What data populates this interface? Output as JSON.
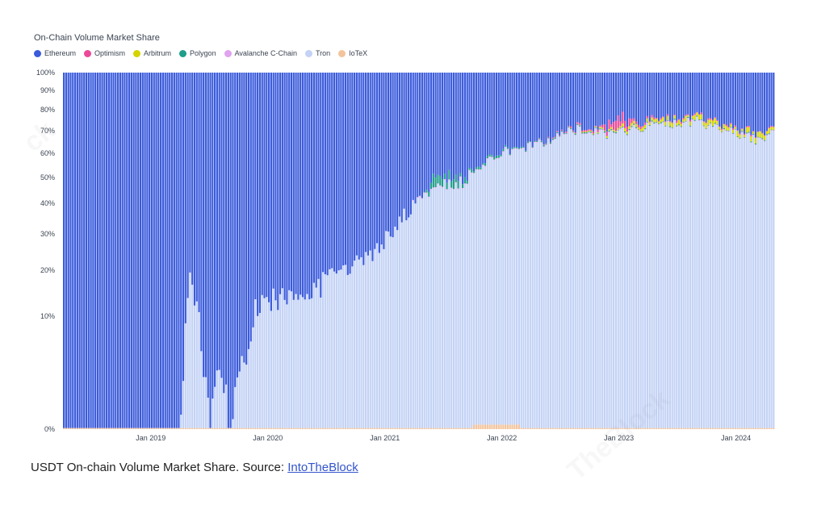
{
  "chart_data": {
    "type": "bar",
    "stacked": true,
    "title": "On-Chain Volume Market Share",
    "y_tick_labels": [
      "0%",
      "10%",
      "20%",
      "30%",
      "40%",
      "50%",
      "60%",
      "70%",
      "80%",
      "90%",
      "100%"
    ],
    "y_tick_values": [
      0,
      10,
      20,
      30,
      40,
      50,
      60,
      70,
      80,
      90,
      100
    ],
    "x_tick_labels": [
      "Jan 2019",
      "Jan 2020",
      "Jan 2021",
      "Jan 2022",
      "Jan 2023",
      "Jan 2024"
    ],
    "x_range": [
      "2018-04",
      "2024-05"
    ],
    "legend_position": "top-left",
    "series": [
      {
        "name": "Ethereum",
        "color": "#3b5bdb"
      },
      {
        "name": "Optimism",
        "color": "#ec4899"
      },
      {
        "name": "Arbitrum",
        "color": "#d4d400"
      },
      {
        "name": "Polygon",
        "color": "#1f9e89"
      },
      {
        "name": "Avalanche C-Chain",
        "color": "#e0a3ef"
      },
      {
        "name": "Tron",
        "color": "#c3d2f5"
      },
      {
        "name": "IoTeX",
        "color": "#f3c49b"
      }
    ],
    "tron_share_anchors": [
      [
        "2018-04",
        0
      ],
      [
        "2019-04",
        0
      ],
      [
        "2019-05",
        18
      ],
      [
        "2019-06",
        8
      ],
      [
        "2019-07",
        1
      ],
      [
        "2019-08",
        3
      ],
      [
        "2019-09",
        1
      ],
      [
        "2019-11",
        9
      ],
      [
        "2019-12",
        12
      ],
      [
        "2020-03",
        14
      ],
      [
        "2020-06",
        16
      ],
      [
        "2020-09",
        20
      ],
      [
        "2020-12",
        24
      ],
      [
        "2021-03",
        36
      ],
      [
        "2021-06",
        46
      ],
      [
        "2021-09",
        48
      ],
      [
        "2021-12",
        58
      ],
      [
        "2022-03",
        62
      ],
      [
        "2022-06",
        66
      ],
      [
        "2022-09",
        71
      ],
      [
        "2022-12",
        68
      ],
      [
        "2023-03",
        71
      ],
      [
        "2023-06",
        73
      ],
      [
        "2023-09",
        74
      ],
      [
        "2023-12",
        70
      ],
      [
        "2024-03",
        66
      ],
      [
        "2024-05",
        68
      ]
    ],
    "polygon_share_anchors": [
      [
        "2021-05",
        0
      ],
      [
        "2021-06",
        4
      ],
      [
        "2021-08",
        3
      ],
      [
        "2021-10",
        1
      ],
      [
        "2022-03",
        0.5
      ],
      [
        "2024-05",
        0.3
      ]
    ],
    "arbitrum_share_anchors": [
      [
        "2022-08",
        0
      ],
      [
        "2023-01",
        1
      ],
      [
        "2023-06",
        1.5
      ],
      [
        "2024-05",
        2
      ]
    ],
    "optimism_share_anchors": [
      [
        "2022-04",
        0
      ],
      [
        "2022-11",
        1
      ],
      [
        "2023-01",
        6
      ],
      [
        "2023-03",
        1
      ],
      [
        "2024-05",
        0.4
      ]
    ]
  },
  "caption": {
    "text": "USDT On-chain Volume Market Share. Source: ",
    "link_text": "IntoTheBlock"
  }
}
